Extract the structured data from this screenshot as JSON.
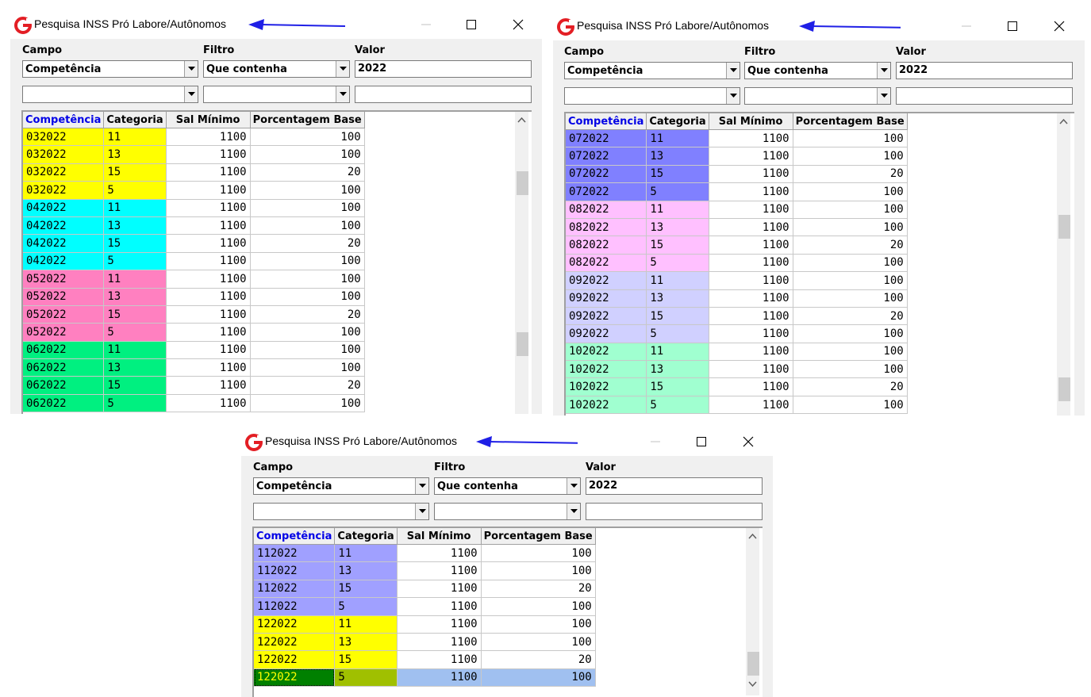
{
  "windows": [
    {
      "title": "Pesquisa INSS Pró Labore/Autônomos",
      "labels": {
        "campo": "Campo",
        "filtro": "Filtro",
        "valor": "Valor"
      },
      "campo_value": "Competência",
      "filtro_value": "Que contenha",
      "valor_value": "2022",
      "campo2_value": "",
      "filtro2_value": "",
      "valor2_value": "",
      "columns": [
        "Competência",
        "Categoria",
        "Sal Mínimo",
        "Porcentagem Base"
      ],
      "rows": [
        {
          "comp": "032022",
          "cat": "11",
          "sal": "1100",
          "pct": "100",
          "color": "#ffff00"
        },
        {
          "comp": "032022",
          "cat": "13",
          "sal": "1100",
          "pct": "100",
          "color": "#ffff00"
        },
        {
          "comp": "032022",
          "cat": "15",
          "sal": "1100",
          "pct": "20",
          "color": "#ffff00"
        },
        {
          "comp": "032022",
          "cat": "5",
          "sal": "1100",
          "pct": "100",
          "color": "#ffff00"
        },
        {
          "comp": "042022",
          "cat": "11",
          "sal": "1100",
          "pct": "100",
          "color": "#00ffff"
        },
        {
          "comp": "042022",
          "cat": "13",
          "sal": "1100",
          "pct": "100",
          "color": "#00ffff"
        },
        {
          "comp": "042022",
          "cat": "15",
          "sal": "1100",
          "pct": "20",
          "color": "#00ffff"
        },
        {
          "comp": "042022",
          "cat": "5",
          "sal": "1100",
          "pct": "100",
          "color": "#00ffff"
        },
        {
          "comp": "052022",
          "cat": "11",
          "sal": "1100",
          "pct": "100",
          "color": "#ff80c0"
        },
        {
          "comp": "052022",
          "cat": "13",
          "sal": "1100",
          "pct": "100",
          "color": "#ff80c0"
        },
        {
          "comp": "052022",
          "cat": "15",
          "sal": "1100",
          "pct": "20",
          "color": "#ff80c0"
        },
        {
          "comp": "052022",
          "cat": "5",
          "sal": "1100",
          "pct": "100",
          "color": "#ff80c0"
        },
        {
          "comp": "062022",
          "cat": "11",
          "sal": "1100",
          "pct": "100",
          "color": "#00f080"
        },
        {
          "comp": "062022",
          "cat": "13",
          "sal": "1100",
          "pct": "100",
          "color": "#00f080"
        },
        {
          "comp": "062022",
          "cat": "15",
          "sal": "1100",
          "pct": "20",
          "color": "#00f080"
        },
        {
          "comp": "062022",
          "cat": "5",
          "sal": "1100",
          "pct": "100",
          "color": "#00f080"
        }
      ]
    },
    {
      "title": "Pesquisa INSS Pró Labore/Autônomos",
      "labels": {
        "campo": "Campo",
        "filtro": "Filtro",
        "valor": "Valor"
      },
      "campo_value": "Competência",
      "filtro_value": "Que contenha",
      "valor_value": "2022",
      "campo2_value": "",
      "filtro2_value": "",
      "valor2_value": "",
      "columns": [
        "Competência",
        "Categoria",
        "Sal Mínimo",
        "Porcentagem Base"
      ],
      "rows": [
        {
          "comp": "072022",
          "cat": "11",
          "sal": "1100",
          "pct": "100",
          "color": "#8080ff"
        },
        {
          "comp": "072022",
          "cat": "13",
          "sal": "1100",
          "pct": "100",
          "color": "#8080ff"
        },
        {
          "comp": "072022",
          "cat": "15",
          "sal": "1100",
          "pct": "20",
          "color": "#8080ff"
        },
        {
          "comp": "072022",
          "cat": "5",
          "sal": "1100",
          "pct": "100",
          "color": "#8080ff"
        },
        {
          "comp": "082022",
          "cat": "11",
          "sal": "1100",
          "pct": "100",
          "color": "#ffc0ff"
        },
        {
          "comp": "082022",
          "cat": "13",
          "sal": "1100",
          "pct": "100",
          "color": "#ffc0ff"
        },
        {
          "comp": "082022",
          "cat": "15",
          "sal": "1100",
          "pct": "20",
          "color": "#ffc0ff"
        },
        {
          "comp": "082022",
          "cat": "5",
          "sal": "1100",
          "pct": "100",
          "color": "#ffc0ff"
        },
        {
          "comp": "092022",
          "cat": "11",
          "sal": "1100",
          "pct": "100",
          "color": "#d0d0ff"
        },
        {
          "comp": "092022",
          "cat": "13",
          "sal": "1100",
          "pct": "100",
          "color": "#d0d0ff"
        },
        {
          "comp": "092022",
          "cat": "15",
          "sal": "1100",
          "pct": "20",
          "color": "#d0d0ff"
        },
        {
          "comp": "092022",
          "cat": "5",
          "sal": "1100",
          "pct": "100",
          "color": "#d0d0ff"
        },
        {
          "comp": "102022",
          "cat": "11",
          "sal": "1100",
          "pct": "100",
          "color": "#a0ffd0"
        },
        {
          "comp": "102022",
          "cat": "13",
          "sal": "1100",
          "pct": "100",
          "color": "#a0ffd0"
        },
        {
          "comp": "102022",
          "cat": "15",
          "sal": "1100",
          "pct": "20",
          "color": "#a0ffd0"
        },
        {
          "comp": "102022",
          "cat": "5",
          "sal": "1100",
          "pct": "100",
          "color": "#a0ffd0"
        }
      ]
    },
    {
      "title": "Pesquisa INSS Pró Labore/Autônomos",
      "labels": {
        "campo": "Campo",
        "filtro": "Filtro",
        "valor": "Valor"
      },
      "campo_value": "Competência",
      "filtro_value": "Que contenha",
      "valor_value": "2022",
      "campo2_value": "",
      "filtro2_value": "",
      "valor2_value": "",
      "columns": [
        "Competência",
        "Categoria",
        "Sal Mínimo",
        "Porcentagem Base"
      ],
      "rows": [
        {
          "comp": "112022",
          "cat": "11",
          "sal": "1100",
          "pct": "100",
          "color": "#a0a0ff"
        },
        {
          "comp": "112022",
          "cat": "13",
          "sal": "1100",
          "pct": "100",
          "color": "#a0a0ff"
        },
        {
          "comp": "112022",
          "cat": "15",
          "sal": "1100",
          "pct": "20",
          "color": "#a0a0ff"
        },
        {
          "comp": "112022",
          "cat": "5",
          "sal": "1100",
          "pct": "100",
          "color": "#a0a0ff"
        },
        {
          "comp": "122022",
          "cat": "11",
          "sal": "1100",
          "pct": "100",
          "color": "#ffff00"
        },
        {
          "comp": "122022",
          "cat": "13",
          "sal": "1100",
          "pct": "100",
          "color": "#ffff00"
        },
        {
          "comp": "122022",
          "cat": "15",
          "sal": "1100",
          "pct": "20",
          "color": "#ffff00"
        },
        {
          "comp": "122022",
          "cat": "5",
          "sal": "1100",
          "pct": "100",
          "color": "#ffff00",
          "selected": true
        }
      ]
    }
  ],
  "colors": {
    "arrow": "#1f1fe6",
    "logo": "#e31e24",
    "header_first_col": "#0000e6",
    "selected_row": "#a0c0f0",
    "selected_first": "#008000",
    "selected_first_text": "#ffff00",
    "selected_cat": "#a0c000"
  },
  "icons": [
    "app-logo-icon",
    "blue-arrow-icon",
    "minimize-icon",
    "maximize-icon",
    "close-icon",
    "dropdown-arrow-icon",
    "scroll-up-icon",
    "scroll-down-icon"
  ]
}
